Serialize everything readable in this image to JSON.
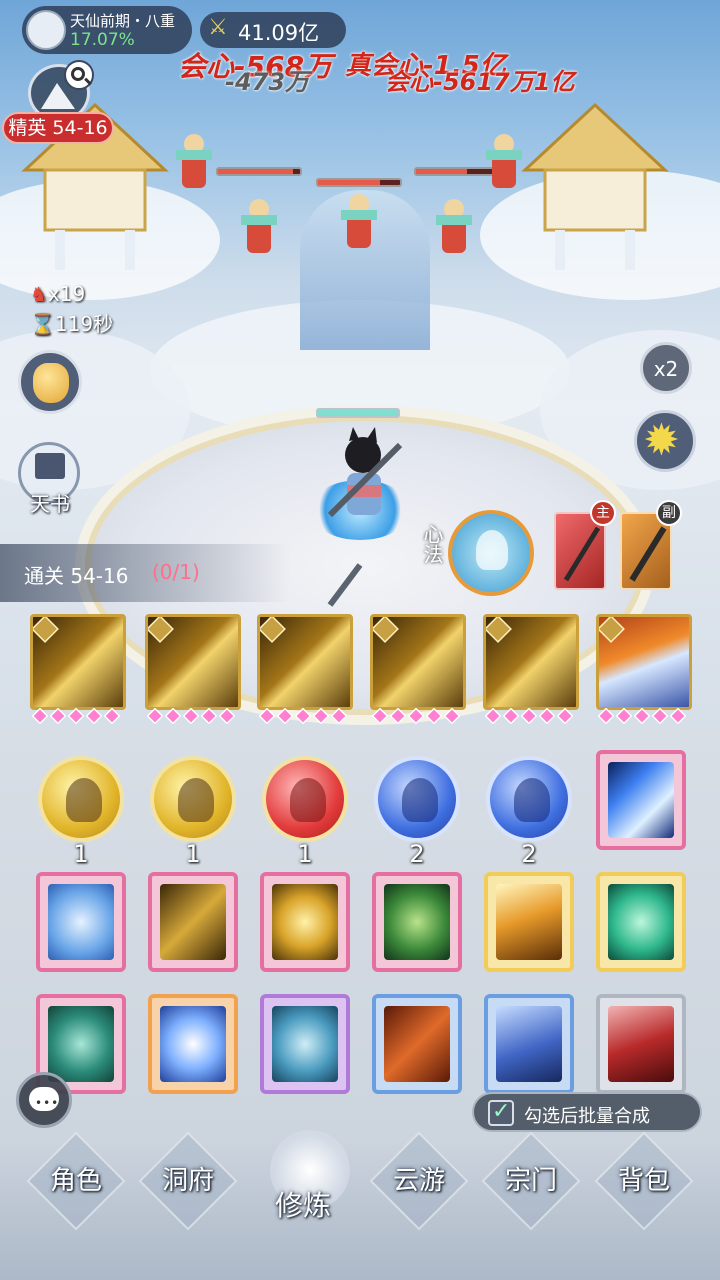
{
  "player": {
    "realm": "天仙前期・八重",
    "progress": "17.07%"
  },
  "power": {
    "value": "41.09亿"
  },
  "damage_texts": [
    "会心-568万",
    "-473万",
    "真会心-1.5亿",
    "会心-5617万1亿"
  ],
  "stage": {
    "label": "精英 54-16"
  },
  "enemy_count": {
    "value": "x19"
  },
  "timer": {
    "value": "119秒"
  },
  "speed": {
    "label": "x2"
  },
  "tianshu": {
    "label": "天书"
  },
  "clear_progress": {
    "label": "通关 54-16",
    "count": "(0/1)"
  },
  "xinfa": {
    "label": "心法"
  },
  "weapons": {
    "main": "主",
    "sub": "副"
  },
  "skills": [
    {
      "gems": 5,
      "icon": "gold-slash-icon"
    },
    {
      "gems": 5,
      "icon": "gold-spear-icon"
    },
    {
      "gems": 5,
      "icon": "gold-sword-icon"
    },
    {
      "gems": 5,
      "icon": "gold-blade-icon"
    },
    {
      "gems": 5,
      "icon": "gold-burst-icon"
    },
    {
      "gems": 5,
      "icon": "fire-beam-icon"
    }
  ],
  "orbs": [
    {
      "color": "gold",
      "count": "1"
    },
    {
      "color": "gold",
      "count": "1"
    },
    {
      "color": "red",
      "count": "1"
    },
    {
      "color": "blue",
      "count": "2"
    },
    {
      "color": "blue",
      "count": "2"
    }
  ],
  "batch": {
    "label": "勾选后批量合成"
  },
  "nav": {
    "items": [
      "角色",
      "洞府",
      "修炼",
      "云游",
      "宗门",
      "背包"
    ],
    "active": "修炼"
  }
}
